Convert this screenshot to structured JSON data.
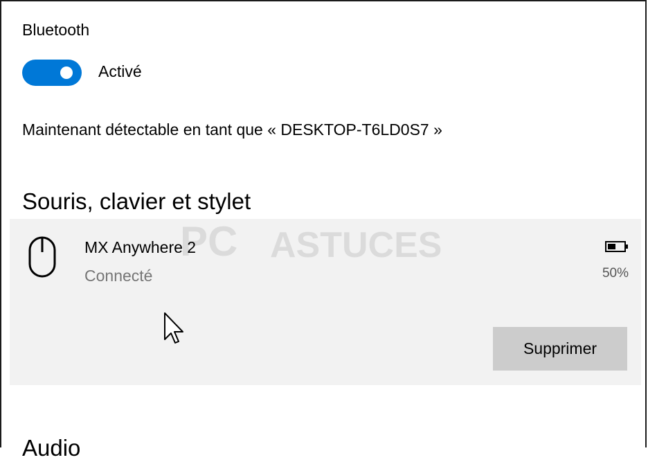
{
  "bluetooth": {
    "label": "Bluetooth",
    "toggle_state": "Activé",
    "discoverable_text": "Maintenant détectable en tant que « DESKTOP-T6LD0S7 »"
  },
  "sections": {
    "mice_title": "Souris, clavier et stylet",
    "audio_title": "Audio"
  },
  "device": {
    "name": "MX Anywhere 2",
    "status": "Connecté",
    "battery": "50%",
    "battery_level": 0.5,
    "icon": "mouse-icon",
    "remove_label": "Supprimer"
  },
  "watermark": {
    "pc": "PC",
    "astuces": "ASTUCES"
  },
  "colors": {
    "accent": "#0078d7",
    "card_bg": "#f2f2f2",
    "button_bg": "#cccccc",
    "secondary_text": "#767676"
  }
}
